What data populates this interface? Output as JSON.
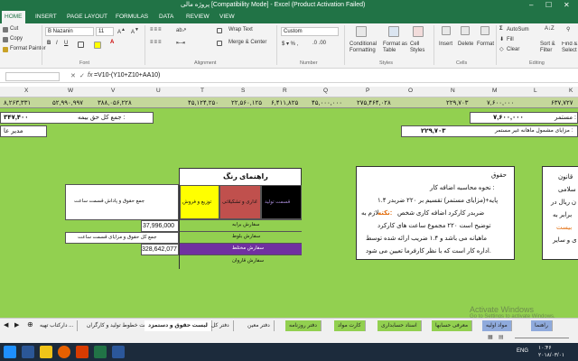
{
  "window": {
    "title": "پروژه مالی  [Compatibility Mode] - Excel (Product Activation Failed)"
  },
  "menu": {
    "file": "FILE",
    "home": "HOME",
    "insert": "INSERT",
    "page_layout": "PAGE LAYOUT",
    "formulas": "FORMULAS",
    "data": "DATA",
    "review": "REVIEW",
    "view": "VIEW"
  },
  "ribbon": {
    "cut": "Cut",
    "copy": "Copy",
    "format_painter": "Format Painter",
    "font_name": "B Nazanin",
    "font_size": "11",
    "wrap_text": "Wrap Text",
    "merge_center": "Merge & Center",
    "number_format": "Custom",
    "conditional_formatting": "Conditional Formatting",
    "format_as_table": "Format as Table",
    "cell_styles": "Cell Styles",
    "insert": "Insert",
    "delete": "Delete",
    "format": "Format",
    "autosum": "AutoSum",
    "fill": "Fill",
    "clear": "Clear",
    "sort_filter": "Sort & Filter",
    "find_select": "Find & Select",
    "groups": {
      "font": "Font",
      "alignment": "Alignment",
      "number": "Number",
      "styles": "Styles",
      "cells": "Cells",
      "editing": "Editing"
    }
  },
  "formula_bar": {
    "cancel": "✕",
    "enter": "✓",
    "fx": "fx",
    "formula": "=V10-(Y10+Z10+AA10)"
  },
  "columns": [
    "X",
    "W",
    "V",
    "U",
    "T",
    "S",
    "R",
    "Q",
    "P",
    "O",
    "N",
    "M",
    "L",
    "K"
  ],
  "sheet": {
    "row1": {
      "x": "۸,۲۶۳,۳۳۱",
      "w": "۵۲,۹۹۰,۹۹۷",
      "v": "۳۸۸,۰۵۶,۲۲۸",
      "t": "۴۵,۱۲۴,۲۵۰",
      "s": "۲۲,۵۶۰,۱۲۵",
      "r": "۶,۴۱۱,۸۲۵",
      "q": "۴۵,۰۰۰,۰۰۰",
      "p": "۲۷۵,۴۶۴,۰۲۸",
      "n": "۲۲۹,۷۰۳",
      "m": "۷,۶۰۰,۰۰۰",
      "k": "۶۳۷,۷۲۷"
    },
    "total_label": "جمع کل حق بیمه :",
    "total_value": "۳۴۷,۴۰۰",
    "manager_label": "مدیر عا",
    "monthly_salary_label": "مستمر :",
    "monthly_salary_value": "۷,۶۰۰,۰۰۰",
    "benefits_label": "مزایای مشمول ماهانه غیر مستمر :",
    "benefits_value": "۲۲۹,۷۰۳"
  },
  "color_guide": {
    "title": "راهنمای رنگ",
    "legend_yellow": "توزیع و فروش",
    "legend_red": "اداری و تشکیلاتی",
    "legend_black": "قسمت تولید",
    "label_wage_total": "جمع حقوق و پاداش قسمت ساعت",
    "value_wage_total": "37,996,000",
    "label_total_benefits": "جمع کل حقوق و مزایای قسمت ساعت",
    "value_total_benefits": "328,642,077",
    "row_green_1": "سفارش برابه",
    "row_green_2": "سفارش بلوط",
    "row_purple": "سفارش مختلط",
    "row_green_3": "سفارش قاروان"
  },
  "overtime_note": {
    "heading": "حقوق",
    "line1": "نحوه محاسبه اضافه کار :",
    "line2": "پایه+(مزایای مستمر) تقسیم بر ۲۲۰ ضربدر ۱.۴",
    "line3": "ضربدر کارکرد اضافه کاری شخص",
    "highlight": "نکته:",
    "line3b": "لازم به",
    "line4": "توضیح است ۲۲۰ مجموع ساعت های کارکرد",
    "line5": "ماهیانه می باشد و ۱.۴ ضریب ارائه شده توسط",
    "line6": "اداره کار است که با نظر کارفرما تعیین می شود."
  },
  "right_note": {
    "line1": "قانون",
    "line2": "سلامی",
    "line3": "ن ریال در",
    "line4": "برابر به",
    "line5": "بیست",
    "line6": "ی و سایر"
  },
  "tabs": [
    "دارکتاب تهیه ...",
    "لیست خطوط تولید و کارگران",
    "لیست حقوق و دستمزد",
    "دفتر کل",
    "دفتر معین",
    "دفتر روزنامه",
    "کارت مواد",
    "اسناد حسابداری",
    "معرفی حسابها",
    "مواد اولیه",
    "راهنما"
  ],
  "tab_colors": [
    "#f0f0f0",
    "#f0f0f0",
    "#ffffff",
    "#f0f0f0",
    "#f0f0f0",
    "#92d050",
    "#92d050",
    "#92d050",
    "#92d050",
    "#8faadc",
    "#8faadc"
  ],
  "watermark": {
    "line1": "Activate Windows",
    "line2": "Go to Settings to activate Windows."
  },
  "taskbar": {
    "lang": "ENG",
    "time": "۱۰:۴۶",
    "date": "۲۰۱۸/۰۳/۰۱"
  },
  "colors": {
    "excel_green": "#217346",
    "sheet_green": "#92d050",
    "yellow": "#ffff00",
    "red": "#c0504d",
    "purple": "#7030a0"
  }
}
